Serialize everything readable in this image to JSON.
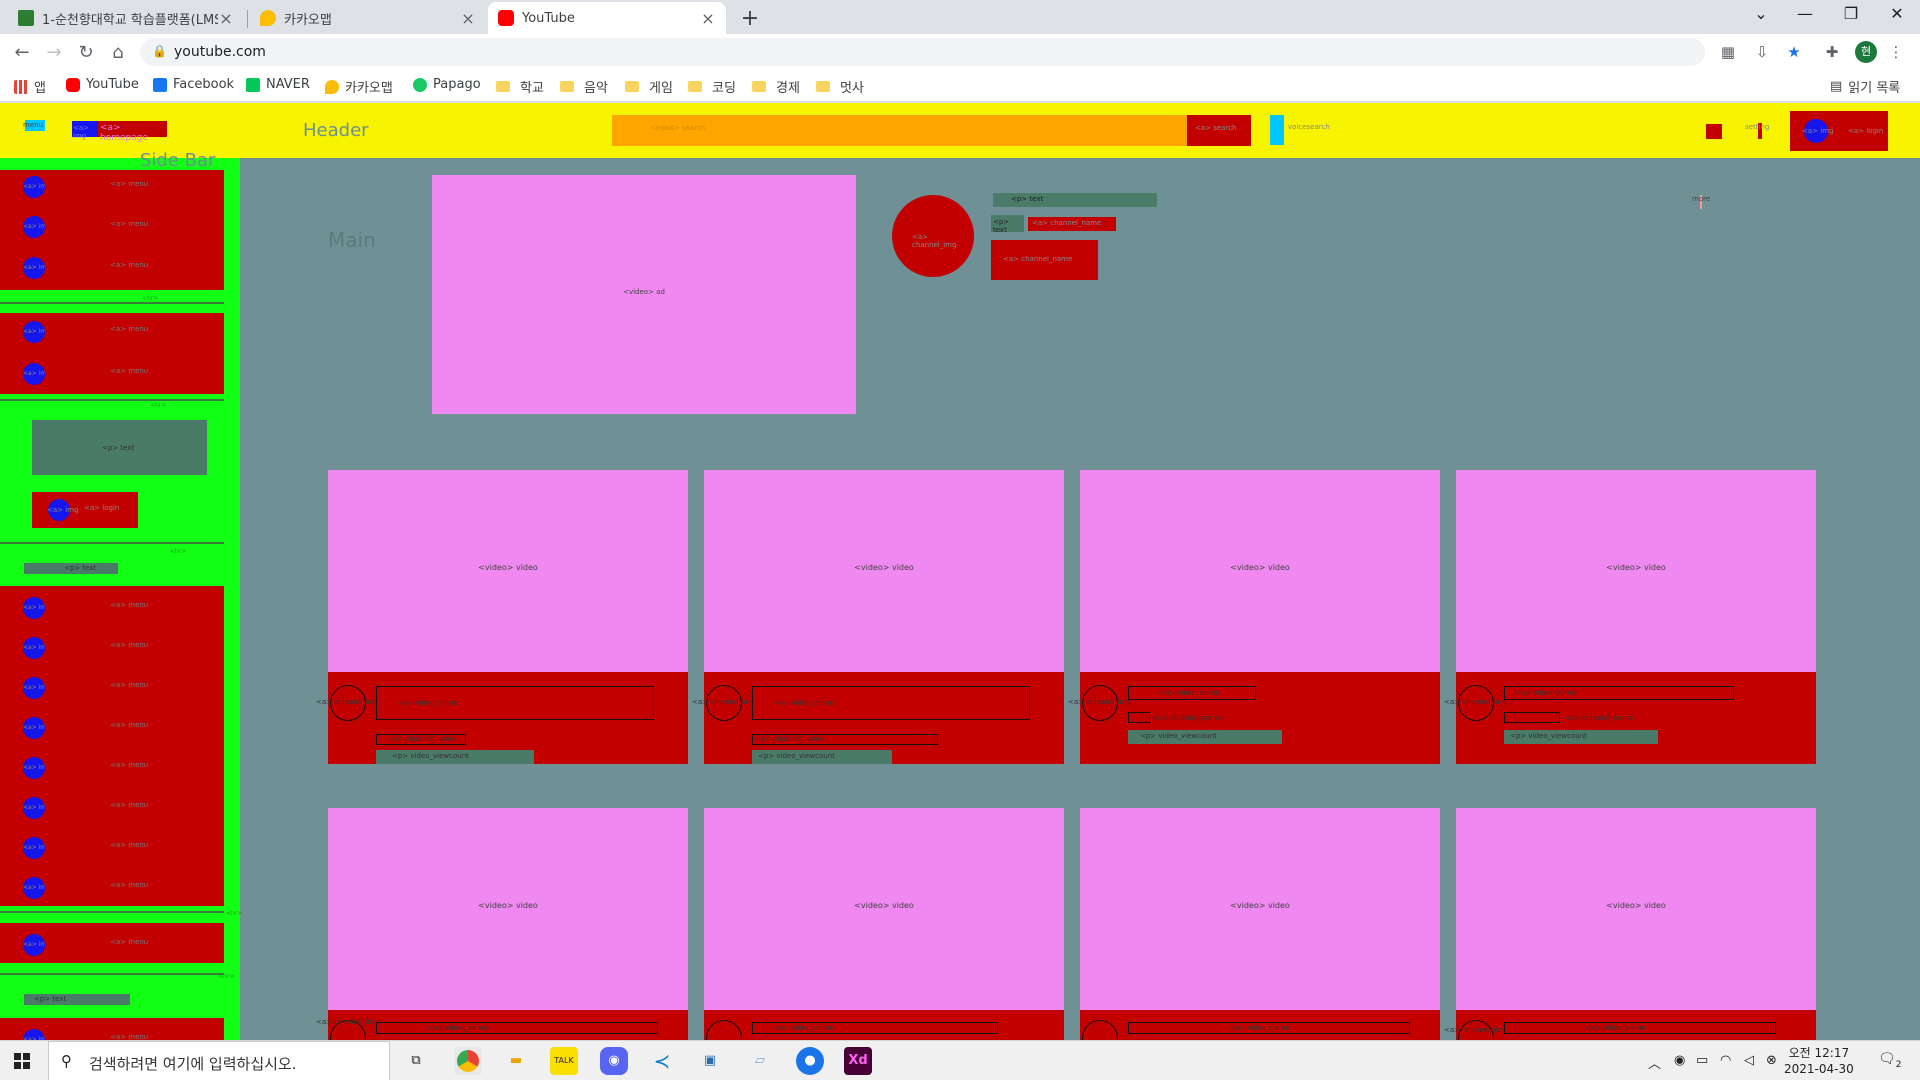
{
  "browser": {
    "tabs": [
      {
        "label": "1-순천향대학교 학습플랫폼(LMS",
        "favicon_color": "#2e7d32",
        "active": false
      },
      {
        "label": "카카오맵",
        "favicon_color": "#fbbc04",
        "active": false
      },
      {
        "label": "YouTube",
        "favicon_color": "#ff0000",
        "active": true
      }
    ],
    "url": "youtube.com",
    "window_controls": {
      "minimize": "—",
      "maximize": "❐",
      "close": "✕"
    },
    "profile_initial": "현"
  },
  "bookmarks": [
    {
      "label": "앱",
      "icon": "apps-grid-icon",
      "color": "#ea4335"
    },
    {
      "label": "YouTube",
      "icon": "youtube-icon",
      "color": "#ff0000"
    },
    {
      "label": "Facebook",
      "icon": "facebook-icon",
      "color": "#1877f2"
    },
    {
      "label": "NAVER",
      "icon": "naver-icon",
      "color": "#03c75a"
    },
    {
      "label": "카카오맵",
      "icon": "kakaomap-icon",
      "color": "#fbbc04"
    },
    {
      "label": "Papago",
      "icon": "papago-icon",
      "color": "#18c964"
    },
    {
      "label": "학교",
      "icon": "folder-icon"
    },
    {
      "label": "음악",
      "icon": "folder-icon"
    },
    {
      "label": "게임",
      "icon": "folder-icon"
    },
    {
      "label": "코딩",
      "icon": "folder-icon"
    },
    {
      "label": "경제",
      "icon": "folder-icon"
    },
    {
      "label": "멋사",
      "icon": "folder-icon"
    }
  ],
  "reading_list": "읽기 목록",
  "page": {
    "header": {
      "title": "Header",
      "menu": "menu",
      "img": "<a> img",
      "homepage": "<a> homepage",
      "search_input": "<input> search",
      "search_button": "<a> search",
      "voicesearch": "voicesearch",
      "setting": "setting",
      "login": "<a> login",
      "img2": "<a> img"
    },
    "sidebar": {
      "title": "Side Bar",
      "menu": "<a> menu",
      "img": "<a> img",
      "hr": "<hr>",
      "text": "<p> text",
      "login": "<a> login"
    },
    "main": {
      "title": "Main",
      "ad": "<video> ad",
      "channel_img": "<a> channel_img",
      "text": "<p> text",
      "channel_name": "<a> channel_name",
      "more": "more",
      "video": "<video> video",
      "video_name": "<a> video_name",
      "video_viewcount": "<p> video_viewcount",
      "channel_name_card": "<a> channel_name"
    }
  },
  "taskbar": {
    "search_placeholder": "검색하려면 여기에 입력하십시오.",
    "time": "오전 12:17",
    "date": "2021-04-30",
    "notifications": "2"
  }
}
